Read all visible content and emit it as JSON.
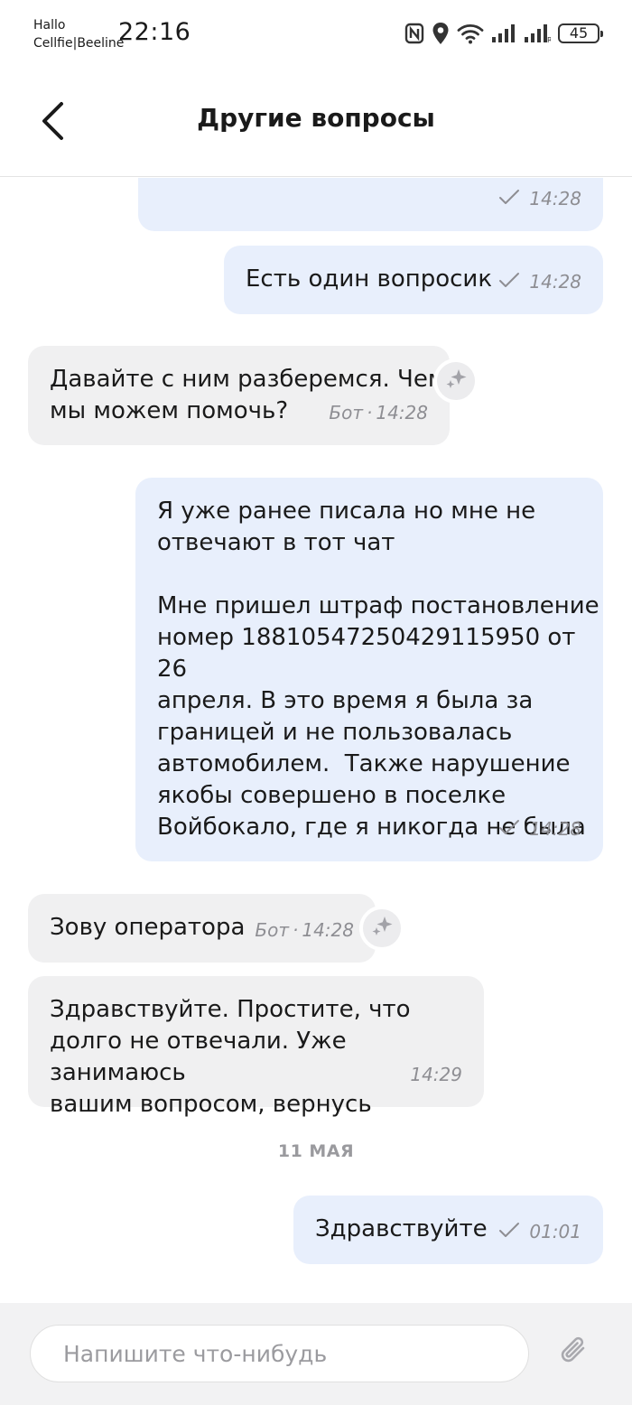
{
  "status_bar": {
    "carrier_line1": "Hallo",
    "carrier_line2": "Cellfie|Beeline",
    "time": "22:16",
    "battery": "45",
    "icons": [
      "nfc-icon",
      "location-icon",
      "wifi-icon",
      "signal-icon",
      "signal-roaming-icon",
      "battery-icon"
    ]
  },
  "header": {
    "title": "Другие вопросы",
    "back_icon": "chevron-left-icon"
  },
  "messages": [
    {
      "side": "out",
      "text": "",
      "time": "14:28",
      "status_icon": "check-icon",
      "partially_visible": true
    },
    {
      "side": "out",
      "text": "Есть один вопросик",
      "time": "14:28",
      "status_icon": "check-icon"
    },
    {
      "side": "in",
      "text": "Давайте с ним разберемся. Чем\nмы можем помочь?",
      "sender": "Бот",
      "time": "14:28",
      "badge_icon": "sparkle-icon"
    },
    {
      "side": "out",
      "text": "Я уже ранее писала но мне не\nотвечают в тот чат\n\nМне пришел штраф постановление\nномер 18810547250429115950 от 26\nапреля. В это время я была за\nграницей и не пользовалась\nавтомобилем.  Также нарушение\nякобы совершено в поселке\nВойбокало, где я никогда не была",
      "time": "14:28",
      "status_icon": "check-icon"
    },
    {
      "side": "in",
      "text": "Зову оператора",
      "sender": "Бот",
      "time": "14:28",
      "badge_icon": "sparkle-icon"
    },
    {
      "side": "in",
      "text": "Здравствуйте. Простите, что\nдолго не отвечали. Уже занимаюсь\nвашим вопросом, вернусь",
      "time": "14:29"
    },
    {
      "side": "out",
      "text": "Здравствуйте",
      "time": "01:01",
      "status_icon": "check-icon"
    }
  ],
  "date_divider": "11 МАЯ",
  "input": {
    "placeholder": "Напишите что-нибудь",
    "value": "",
    "attach_icon": "paperclip-icon"
  },
  "colors": {
    "outgoing_bubble": "#e8effc",
    "incoming_bubble": "#f0f0f1",
    "meta_text": "#8e8e93",
    "input_bar": "#f2f2f3"
  }
}
